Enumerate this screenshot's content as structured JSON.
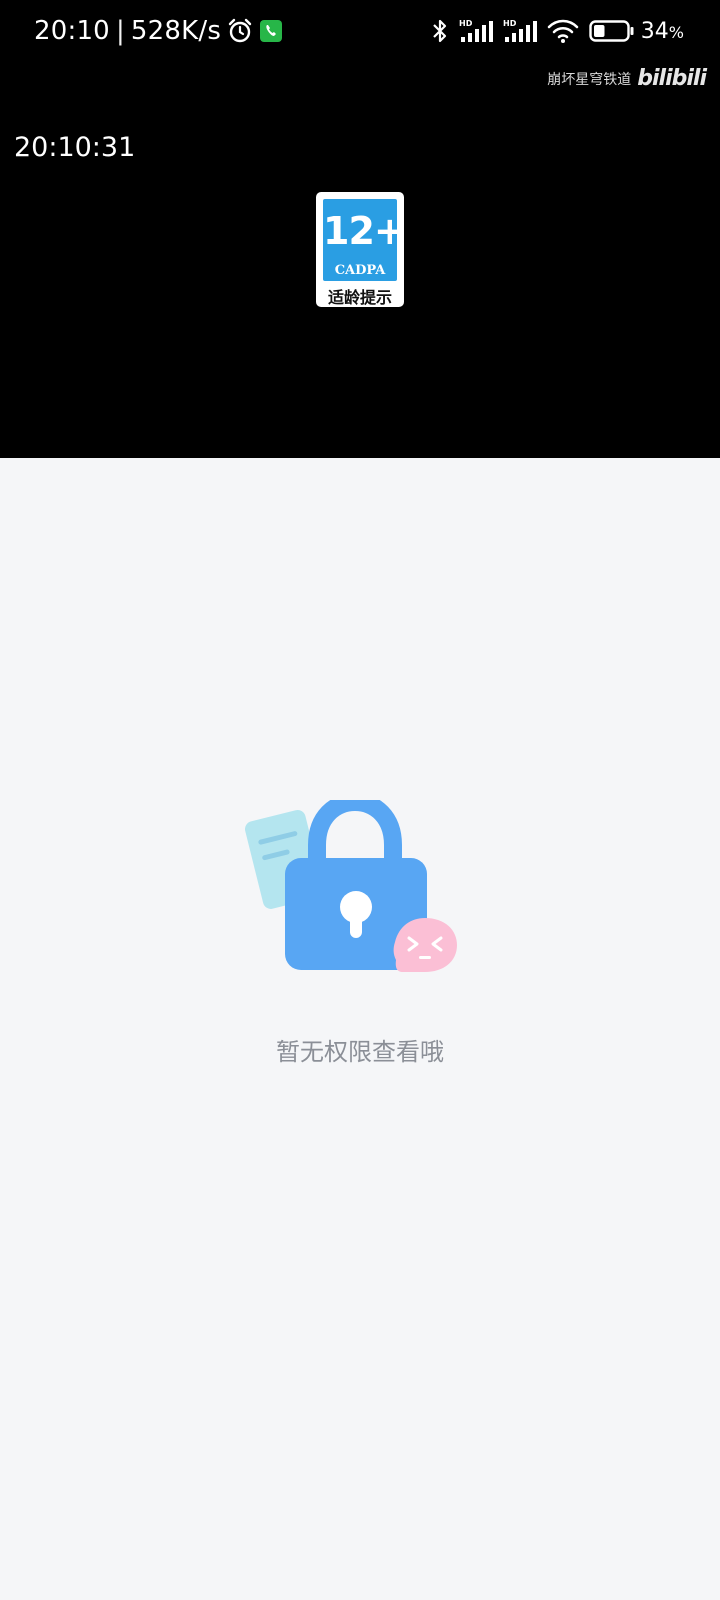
{
  "status_bar": {
    "time": "20:10",
    "separator": "|",
    "net_speed": "528K/s",
    "alarm_icon": "alarm-icon",
    "call_icon": "phone-call-icon",
    "bluetooth_icon": "bluetooth-icon",
    "signal_1_label": "HD",
    "signal_2_label": "HD",
    "wifi_icon": "wifi-icon",
    "battery_level": 34,
    "battery_text": "34",
    "battery_unit": "%"
  },
  "player": {
    "watermark_text": "崩坏星穹铁道",
    "watermark_logo": "bilibili",
    "clock": "20:10:31",
    "age_rating": {
      "number": "12+",
      "org": "CADPA",
      "label": "适龄提示"
    }
  },
  "empty_state": {
    "illustration": "lock-icon",
    "message": "暂无权限查看哦"
  },
  "colors": {
    "player_bg": "#000000",
    "page_bg": "#f5f6f8",
    "lock_blue": "#58a6f3",
    "note_cyan": "#b4e5ef",
    "bubble_pink": "#fbbfd5",
    "badge_blue": "#2a9ee3",
    "message_gray": "#8b8f97",
    "call_green": "#27b648"
  }
}
